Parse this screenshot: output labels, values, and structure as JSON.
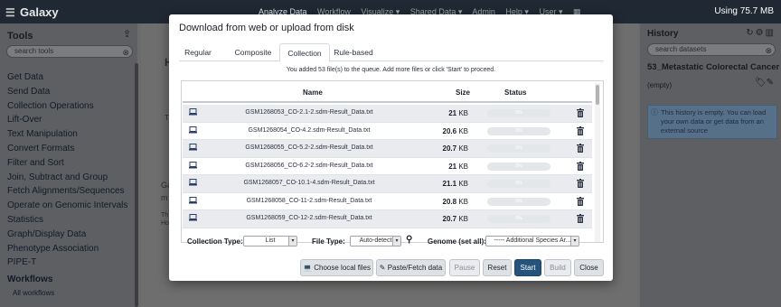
{
  "masthead": {
    "brand": "Galaxy",
    "nav": [
      "Analyze Data",
      "Workflow",
      "Visualize ▾",
      "Shared Data ▾",
      "Admin",
      "Help ▾",
      "User ▾"
    ],
    "usage": "Using 75.7 MB"
  },
  "tools": {
    "title": "Tools",
    "search_placeholder": "search tools",
    "items": [
      "Get Data",
      "Send Data",
      "Collection Operations",
      "Lift-Over",
      "Text Manipulation",
      "Convert Formats",
      "Filter and Sort",
      "Join, Subtract and Group",
      "Fetch Alignments/Sequences",
      "Operate on Genomic Intervals",
      "Statistics",
      "Graph/Display Data",
      "Phenotype Association",
      "PIPE-T"
    ],
    "workflows_title": "Workflows",
    "all_workflows": "All workflows"
  },
  "center": {
    "stub_h": "H",
    "stub_t": "T",
    "stub_g": "Ga",
    "stub_m": "m",
    "stub_th": "Th",
    "stub_ho": "Ho"
  },
  "history": {
    "title": "History",
    "search_placeholder": "search datasets",
    "name": "53_Metastatic Colorectal Cancer",
    "empty": "(empty)",
    "info": "This history is empty. You can load your own data or get data from an external source"
  },
  "modal": {
    "title": "Download from web or upload from disk",
    "tabs": [
      "Regular",
      "Composite",
      "Collection",
      "Rule-based"
    ],
    "active_tab": "Collection",
    "queue_message": "You added 53 file(s) to the queue. Add more files or click 'Start' to proceed.",
    "columns": {
      "name": "Name",
      "size": "Size",
      "status": "Status"
    },
    "rows": [
      {
        "name": "GSM1268053_CO-2.1-2.sdm-Result_Data.txt",
        "size_num": "21",
        "size_unit": "KB",
        "progress": "0%"
      },
      {
        "name": "GSM1268054_CO-4.2.sdm-Result_Data.txt",
        "size_num": "20.6",
        "size_unit": "KB",
        "progress": "0%"
      },
      {
        "name": "GSM1268055_CO-5.2-2.sdm-Result_Data.txt",
        "size_num": "20.7",
        "size_unit": "KB",
        "progress": "0%"
      },
      {
        "name": "GSM1268056_CO-6.2-2.sdm-Result_Data.txt",
        "size_num": "21",
        "size_unit": "KB",
        "progress": "0%"
      },
      {
        "name": "GSM1268057_CO-10.1-4.sdm-Result_Data.txt",
        "size_num": "21.1",
        "size_unit": "KB",
        "progress": "0%"
      },
      {
        "name": "GSM1268058_CO-11-2.sdm-Result_Data.txt",
        "size_num": "20.8",
        "size_unit": "KB",
        "progress": "0%"
      },
      {
        "name": "GSM1268059_CO-12-2.sdm-Result_Data.txt",
        "size_num": "20.7",
        "size_unit": "KB",
        "progress": "0%"
      }
    ],
    "options": {
      "collection_type_label": "Collection Type:",
      "collection_type_value": "List",
      "file_type_label": "File Type:",
      "file_type_value": "Auto-detect",
      "genome_label": "Genome (set all):",
      "genome_value": "----- Additional Species Ar..."
    },
    "buttons": {
      "choose_local": "Choose local files",
      "paste_fetch": "Paste/Fetch data",
      "pause": "Pause",
      "reset": "Reset",
      "start": "Start",
      "build": "Build",
      "close": "Close"
    }
  },
  "colors": {
    "masthead": "#1f2833",
    "primary": "#25537b",
    "modal_bg": "#ffffff"
  }
}
